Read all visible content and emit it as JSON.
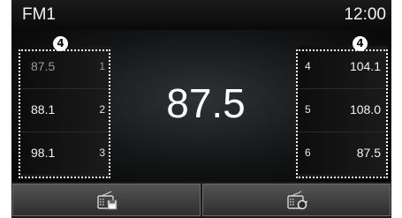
{
  "header": {
    "band": "FM1",
    "clock": "12:00"
  },
  "current_frequency": "87.5",
  "callout_label": "4",
  "presets_left": [
    {
      "freq": "87.5",
      "num": "1"
    },
    {
      "freq": "88.1",
      "num": "2"
    },
    {
      "freq": "98.1",
      "num": "3"
    }
  ],
  "presets_right": [
    {
      "num": "4",
      "freq": "104.1"
    },
    {
      "num": "5",
      "freq": "108.0"
    },
    {
      "num": "6",
      "freq": "87.5"
    }
  ],
  "bottom_buttons": [
    {
      "icon": "radio-save-icon"
    },
    {
      "icon": "radio-scan-icon"
    }
  ]
}
